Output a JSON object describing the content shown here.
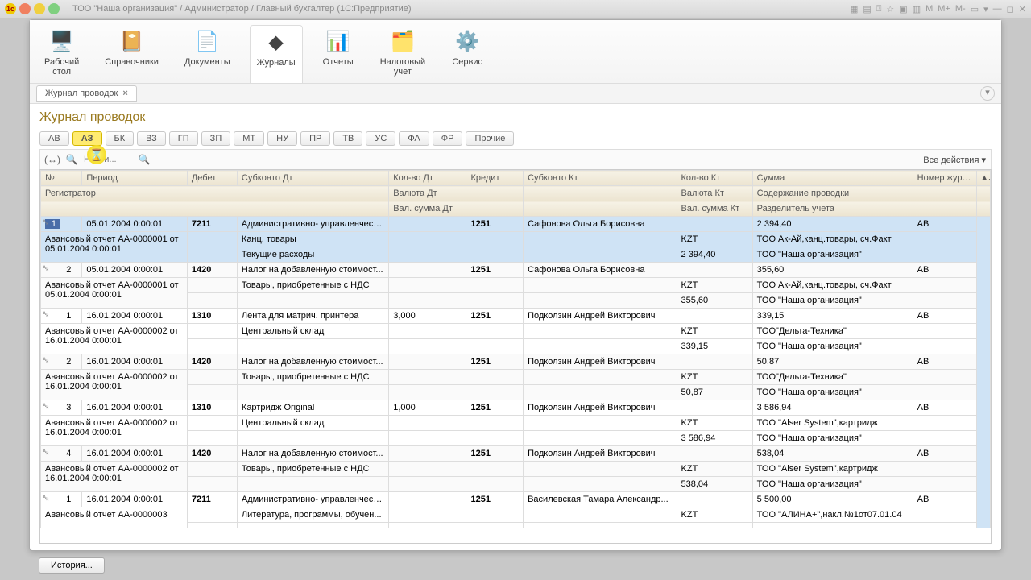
{
  "window": {
    "title": "ТОО \"Наша организация\" / Администратор / Главный бухгалтер  (1С:Предприятие)",
    "toolbar_letters": [
      "M",
      "M+",
      "M-"
    ]
  },
  "ribbon": [
    {
      "label": "Рабочий\nстол",
      "icon": "🖥️"
    },
    {
      "label": "Справочники",
      "icon": "📔"
    },
    {
      "label": "Документы",
      "icon": "📄"
    },
    {
      "label": "Журналы",
      "icon": "◆",
      "active": true
    },
    {
      "label": "Отчеты",
      "icon": "📊"
    },
    {
      "label": "Налоговый\nучет",
      "icon": "🗂️"
    },
    {
      "label": "Сервис",
      "icon": "⚙️"
    }
  ],
  "tab": {
    "label": "Журнал проводок"
  },
  "page_title": "Журнал проводок",
  "pills": [
    "АВ",
    "АЗ",
    "БК",
    "ВЗ",
    "ГП",
    "ЗП",
    "МТ",
    "НУ",
    "ПР",
    "ТВ",
    "УС",
    "ФА",
    "ФР",
    "Прочие"
  ],
  "active_pill": "АЗ",
  "toolbar": {
    "search_placeholder": "Найти...",
    "actions": "Все действия ▾"
  },
  "columns": {
    "r1": [
      "№",
      "Период",
      "Дебет",
      "Субконто Дт",
      "Кол-во Дт",
      "Кредит",
      "Субконто Кт",
      "Кол-во Кт",
      "Сумма",
      "Номер журнала"
    ],
    "r2": [
      "Регистратор",
      "",
      "",
      "",
      "Валюта Дт",
      "",
      "",
      "Валюта Кт",
      "Содержание проводки",
      ""
    ],
    "r3": [
      "",
      "",
      "",
      "",
      "Вал. сумма Дт",
      "",
      "",
      "Вал. сумма Кт",
      "Разделитель учета",
      ""
    ]
  },
  "rows": [
    {
      "selected": true,
      "idx": "1",
      "period": "05.01.2004 0:00:01",
      "debit": "7211",
      "sub_dt": [
        "Административно- управленческ...",
        "Канц. товары",
        "Текущие расходы"
      ],
      "qty_dt": [
        "",
        "",
        ""
      ],
      "credit": "1251",
      "sub_kt": [
        "Сафонова Ольга Борисовна",
        "",
        ""
      ],
      "qty_kt": [
        "",
        "KZT",
        "2 394,40"
      ],
      "sum": [
        "2 394,40",
        "ТОО Ак-Ай,канц.товары, сч.Факт",
        "ТОО \"Наша организация\""
      ],
      "jr": "АВ",
      "reg": "Авансовый отчет АА-0000001 от 05.01.2004 0:00:01"
    },
    {
      "idx": "2",
      "period": "05.01.2004 0:00:01",
      "debit": "1420",
      "sub_dt": [
        "Налог на добавленную стоимост...",
        "Товары, приобретенные с НДС",
        ""
      ],
      "qty_dt": [
        "",
        "",
        ""
      ],
      "credit": "1251",
      "sub_kt": [
        "Сафонова Ольга Борисовна",
        "",
        ""
      ],
      "qty_kt": [
        "",
        "KZT",
        "355,60"
      ],
      "sum": [
        "355,60",
        "ТОО Ак-Ай,канц.товары, сч.Факт",
        "ТОО \"Наша организация\""
      ],
      "jr": "АВ",
      "reg": "Авансовый отчет АА-0000001 от 05.01.2004 0:00:01"
    },
    {
      "idx": "1",
      "period": "16.01.2004 0:00:01",
      "debit": "1310",
      "sub_dt": [
        "Лента для матрич. принтера",
        "Центральный склад",
        ""
      ],
      "qty_dt": [
        "3,000",
        "",
        ""
      ],
      "credit": "1251",
      "sub_kt": [
        "Подколзин Андрей Викторович",
        "",
        ""
      ],
      "qty_kt": [
        "",
        "KZT",
        "339,15"
      ],
      "sum": [
        "339,15",
        "ТОО\"Дельта-Техника\"",
        "ТОО \"Наша организация\""
      ],
      "jr": "АВ",
      "reg": "Авансовый отчет АА-0000002 от 16.01.2004 0:00:01"
    },
    {
      "idx": "2",
      "period": "16.01.2004 0:00:01",
      "debit": "1420",
      "sub_dt": [
        "Налог на добавленную стоимост...",
        "Товары, приобретенные с НДС",
        ""
      ],
      "qty_dt": [
        "",
        "",
        ""
      ],
      "credit": "1251",
      "sub_kt": [
        "Подколзин Андрей Викторович",
        "",
        ""
      ],
      "qty_kt": [
        "",
        "KZT",
        "50,87"
      ],
      "sum": [
        "50,87",
        "ТОО\"Дельта-Техника\"",
        "ТОО \"Наша организация\""
      ],
      "jr": "АВ",
      "reg": "Авансовый отчет АА-0000002 от 16.01.2004 0:00:01"
    },
    {
      "idx": "3",
      "period": "16.01.2004 0:00:01",
      "debit": "1310",
      "sub_dt": [
        "Картридж Original",
        "Центральный склад",
        ""
      ],
      "qty_dt": [
        "1,000",
        "",
        ""
      ],
      "credit": "1251",
      "sub_kt": [
        "Подколзин Андрей Викторович",
        "",
        ""
      ],
      "qty_kt": [
        "",
        "KZT",
        "3 586,94"
      ],
      "sum": [
        "3 586,94",
        "ТОО \"Alser System\",картридж",
        "ТОО \"Наша организация\""
      ],
      "jr": "АВ",
      "reg": "Авансовый отчет АА-0000002 от 16.01.2004 0:00:01"
    },
    {
      "idx": "4",
      "period": "16.01.2004 0:00:01",
      "debit": "1420",
      "sub_dt": [
        "Налог на добавленную стоимост...",
        "Товары, приобретенные с НДС",
        ""
      ],
      "qty_dt": [
        "",
        "",
        ""
      ],
      "credit": "1251",
      "sub_kt": [
        "Подколзин Андрей Викторович",
        "",
        ""
      ],
      "qty_kt": [
        "",
        "KZT",
        "538,04"
      ],
      "sum": [
        "538,04",
        "ТОО \"Alser System\",картридж",
        "ТОО \"Наша организация\""
      ],
      "jr": "АВ",
      "reg": "Авансовый отчет АА-0000002 от 16.01.2004 0:00:01"
    },
    {
      "idx": "1",
      "period": "16.01.2004 0:00:01",
      "debit": "7211",
      "sub_dt": [
        "Административно- управленческ...",
        "Литература, программы, обучен...",
        ""
      ],
      "qty_dt": [
        "",
        "",
        ""
      ],
      "credit": "1251",
      "sub_kt": [
        "Василевская Тамара Александр...",
        "",
        ""
      ],
      "qty_kt": [
        "",
        "KZT",
        ""
      ],
      "sum": [
        "5 500,00",
        "ТОО \"АЛИНА+\",накл.№1от07.01.04",
        ""
      ],
      "jr": "АВ",
      "reg": "Авансовый отчет АА-0000003"
    }
  ],
  "history_btn": "История..."
}
